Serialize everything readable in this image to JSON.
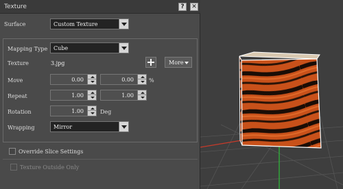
{
  "dialog": {
    "title": "Texture",
    "help_label": "?",
    "close_label": "✕"
  },
  "surface": {
    "label": "Surface",
    "value": "Custom Texture"
  },
  "mapping": {
    "type_label": "Mapping Type",
    "type_value": "Cube",
    "texture_label": "Texture",
    "texture_file": "3.jpg",
    "more_label": "More"
  },
  "move": {
    "label": "Move",
    "x": "0.00",
    "y": "0.00",
    "unit": "%"
  },
  "repeat": {
    "label": "Repeat",
    "x": "1.00",
    "y": "1.00"
  },
  "rotation": {
    "label": "Rotation",
    "value": "1.00",
    "unit": "Deg"
  },
  "wrapping": {
    "label": "Wrapping",
    "value": "Mirror"
  },
  "override": {
    "label": "Override Slice Settings",
    "checked": false
  },
  "texture_outside": {
    "label": "Texture Outside Only",
    "checked": false,
    "enabled": false
  },
  "colors": {
    "panel_bg": "#4a4a4a",
    "viewport_bg": "#3e3e3e",
    "texture_orange": "#c8511a",
    "texture_dark": "#1a0d06",
    "axis_green": "#2fbf3a",
    "axis_red": "#c83a2a"
  }
}
